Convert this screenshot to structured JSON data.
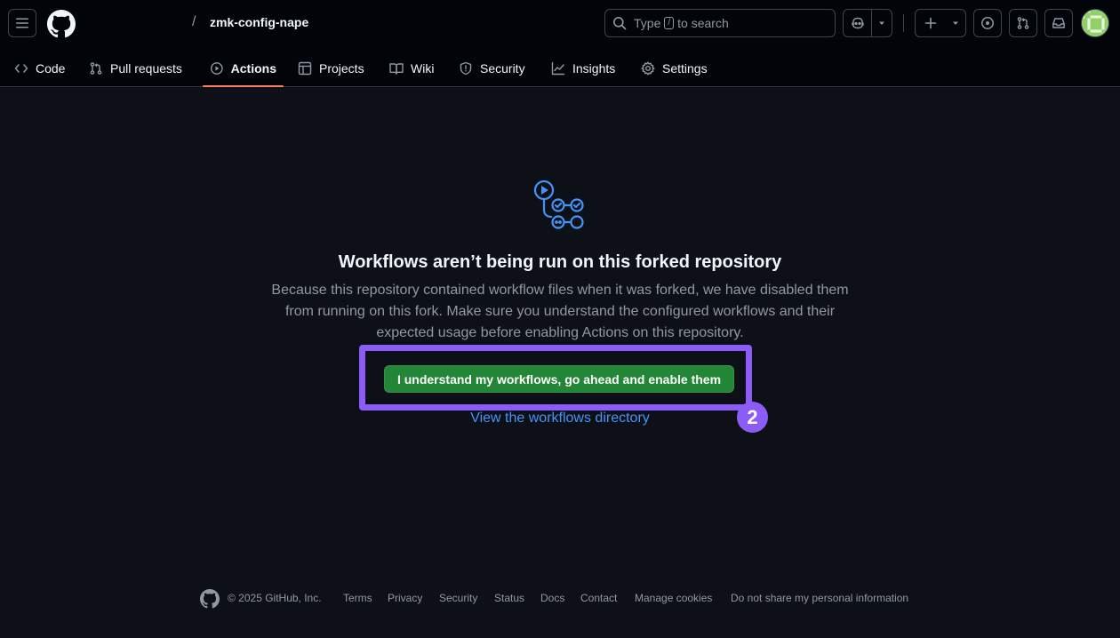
{
  "header": {
    "repo_name": "zmk-config-nape",
    "breadcrumb_separator": "/",
    "search": {
      "prefix": "Type",
      "key": "/",
      "suffix": "to search"
    }
  },
  "tabs": [
    {
      "label": "Code",
      "icon": "code-icon"
    },
    {
      "label": "Pull requests",
      "icon": "git-pull-request-icon"
    },
    {
      "label": "Actions",
      "icon": "play-icon",
      "active": true
    },
    {
      "label": "Projects",
      "icon": "table-icon"
    },
    {
      "label": "Wiki",
      "icon": "book-icon"
    },
    {
      "label": "Security",
      "icon": "shield-icon"
    },
    {
      "label": "Insights",
      "icon": "graph-icon"
    },
    {
      "label": "Settings",
      "icon": "gear-icon"
    }
  ],
  "main": {
    "title": "Workflows aren’t being run on this forked repository",
    "description": "Because this repository contained workflow files when it was forked, we have disabled them from running on this fork. Make sure you understand the configured workflows and their expected usage before enabling Actions on this repository.",
    "enable_button": "I understand my workflows, go ahead and enable them",
    "step_badge": "2",
    "directory_link": "View the workflows directory"
  },
  "footer": {
    "copyright": "© 2025 GitHub, Inc.",
    "links": [
      "Terms",
      "Privacy",
      "Security",
      "Status",
      "Docs",
      "Contact",
      "Manage cookies",
      "Do not share my personal information"
    ]
  },
  "colors": {
    "background": "#0d1117",
    "header_background": "#010409",
    "primary_button": "#238636",
    "link": "#4493f8",
    "highlight": "#8b5cf6",
    "active_tab_underline": "#f78166"
  }
}
